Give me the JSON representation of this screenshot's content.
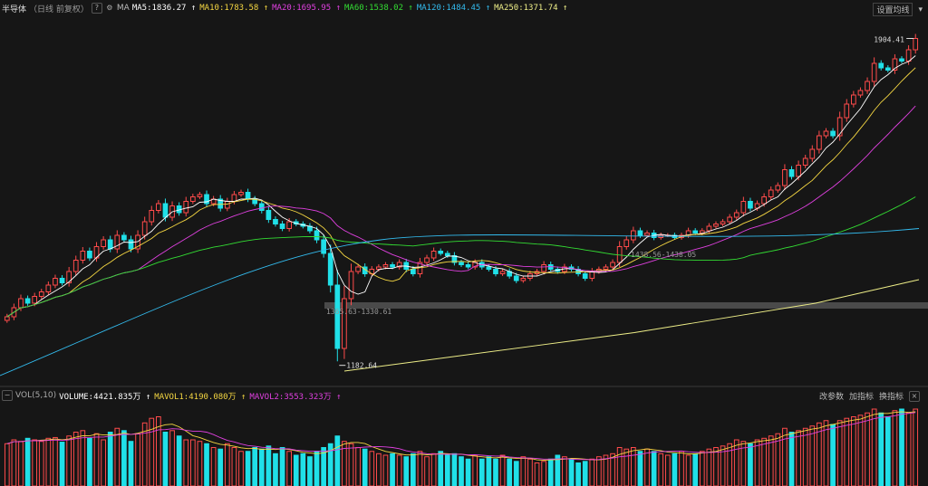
{
  "header": {
    "title": "半导体",
    "period": "（日线 前复权）",
    "ma_label": "MA",
    "ma_items": [
      {
        "name": "MA5",
        "value": "1836.27",
        "color": "#ffffff"
      },
      {
        "name": "MA10",
        "value": "1783.58",
        "color": "#f5d742"
      },
      {
        "name": "MA20",
        "value": "1695.95",
        "color": "#e040e0"
      },
      {
        "name": "MA60",
        "value": "1538.02",
        "color": "#33dd33"
      },
      {
        "name": "MA120",
        "value": "1484.45",
        "color": "#33bbee"
      },
      {
        "name": "MA250",
        "value": "1371.74",
        "color": "#eeee88"
      }
    ],
    "settings_label": "设置均线"
  },
  "volume_header": {
    "label": "VOL(5,10)",
    "items": [
      {
        "name": "VOLUME",
        "value": "4421.835万",
        "color": "#ffffff"
      },
      {
        "name": "MAVOL1",
        "value": "4190.080万",
        "color": "#f5d742"
      },
      {
        "name": "MAVOL2",
        "value": "3553.323万",
        "color": "#e040e0"
      }
    ],
    "buttons": [
      "改参数",
      "加指标",
      "换指标"
    ]
  },
  "annotations": {
    "high": "1904.41",
    "low": "1182.64",
    "range1": "1365.63-1330.61",
    "range2": "1438.56-1438.05"
  },
  "chart_data": {
    "type": "candlestick",
    "ylim": [
      1150,
      1950
    ],
    "close": [
      1290,
      1310,
      1330,
      1320,
      1335,
      1345,
      1360,
      1375,
      1365,
      1390,
      1415,
      1435,
      1420,
      1445,
      1460,
      1440,
      1470,
      1460,
      1440,
      1470,
      1500,
      1525,
      1540,
      1510,
      1535,
      1520,
      1545,
      1555,
      1560,
      1540,
      1550,
      1530,
      1545,
      1560,
      1565,
      1550,
      1540,
      1525,
      1505,
      1495,
      1485,
      1500,
      1495,
      1490,
      1480,
      1460,
      1430,
      1360,
      1220,
      1330,
      1390,
      1400,
      1385,
      1395,
      1400,
      1405,
      1400,
      1410,
      1395,
      1385,
      1410,
      1420,
      1435,
      1430,
      1425,
      1410,
      1405,
      1400,
      1410,
      1400,
      1395,
      1385,
      1390,
      1380,
      1370,
      1375,
      1385,
      1390,
      1405,
      1395,
      1390,
      1400,
      1395,
      1385,
      1375,
      1390,
      1395,
      1400,
      1410,
      1445,
      1460,
      1480,
      1470,
      1475,
      1465,
      1470,
      1470,
      1465,
      1470,
      1480,
      1475,
      1480,
      1490,
      1495,
      1500,
      1510,
      1520,
      1545,
      1530,
      1540,
      1555,
      1570,
      1580,
      1615,
      1600,
      1625,
      1640,
      1660,
      1690,
      1700,
      1690,
      1730,
      1760,
      1780,
      1790,
      1810,
      1850,
      1840,
      1835,
      1860,
      1855,
      1880,
      1905
    ],
    "volume": [
      0.55,
      0.6,
      0.58,
      0.62,
      0.6,
      0.58,
      0.62,
      0.63,
      0.57,
      0.65,
      0.7,
      0.72,
      0.62,
      0.68,
      0.6,
      0.7,
      0.75,
      0.72,
      0.58,
      0.68,
      0.82,
      0.88,
      0.9,
      0.7,
      0.72,
      0.65,
      0.6,
      0.6,
      0.58,
      0.55,
      0.5,
      0.48,
      0.55,
      0.5,
      0.45,
      0.45,
      0.5,
      0.48,
      0.52,
      0.42,
      0.5,
      0.45,
      0.4,
      0.42,
      0.38,
      0.45,
      0.5,
      0.55,
      0.65,
      0.58,
      0.55,
      0.5,
      0.48,
      0.45,
      0.42,
      0.4,
      0.42,
      0.4,
      0.38,
      0.42,
      0.45,
      0.38,
      0.42,
      0.45,
      0.4,
      0.42,
      0.38,
      0.35,
      0.4,
      0.35,
      0.38,
      0.35,
      0.4,
      0.35,
      0.32,
      0.38,
      0.35,
      0.3,
      0.32,
      0.35,
      0.4,
      0.38,
      0.35,
      0.3,
      0.32,
      0.35,
      0.38,
      0.4,
      0.42,
      0.5,
      0.48,
      0.5,
      0.45,
      0.48,
      0.45,
      0.42,
      0.4,
      0.42,
      0.45,
      0.4,
      0.42,
      0.45,
      0.48,
      0.5,
      0.52,
      0.55,
      0.6,
      0.58,
      0.55,
      0.6,
      0.62,
      0.65,
      0.68,
      0.75,
      0.7,
      0.72,
      0.75,
      0.78,
      0.82,
      0.85,
      0.8,
      0.85,
      0.88,
      0.9,
      0.92,
      0.95,
      1.0,
      0.95,
      0.9,
      0.98,
      1.0,
      0.95,
      1.0
    ]
  }
}
